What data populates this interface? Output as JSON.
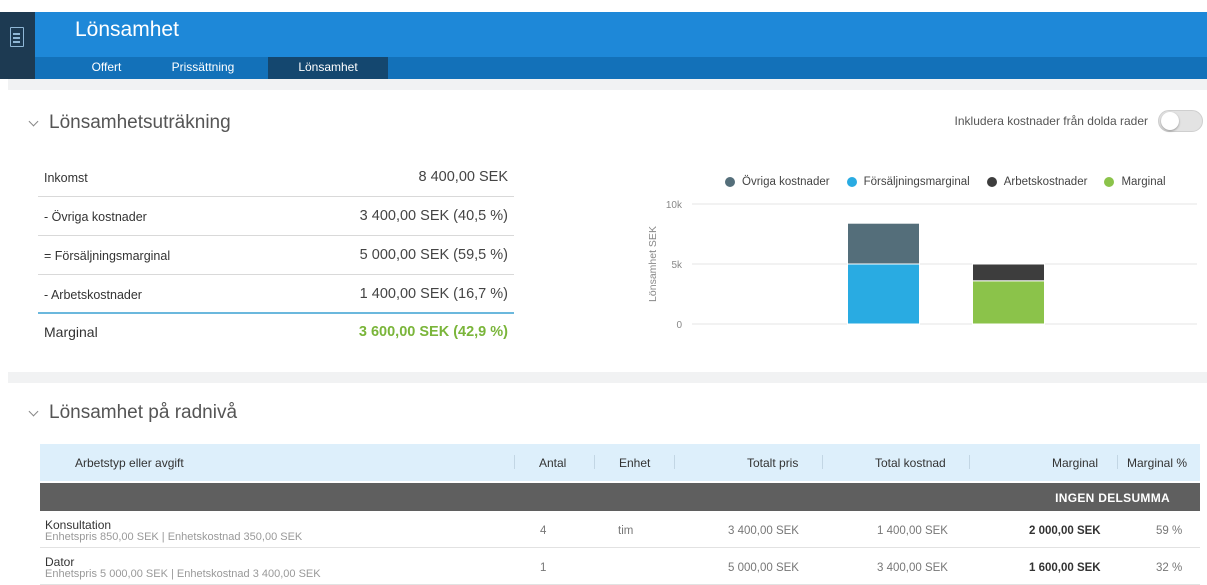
{
  "header": {
    "title": "Lönsamhet",
    "tabs": [
      {
        "label": "Offert"
      },
      {
        "label": "Prissättning"
      },
      {
        "label": "Lönsamhet"
      }
    ],
    "active_tab": "Lönsamhet",
    "colors": {
      "title_bar": "#1e88d8",
      "tab_bar": "#1371b9",
      "active_tab": "#14476f"
    }
  },
  "calculation": {
    "title": "Lönsamhetsuträkning",
    "toggle_label": "Inkludera kostnader från dolda rader",
    "toggle_on": false,
    "rows": [
      {
        "label": "Inkomst",
        "value": "8 400,00 SEK"
      },
      {
        "label": "- Övriga kostnader",
        "value": "3 400,00 SEK  (40,5 %)"
      },
      {
        "label": "= Försäljningsmarginal",
        "value": "5 000,00 SEK  (59,5 %)"
      },
      {
        "label": "- Arbetskostnader",
        "value": "1 400,00 SEK  (16,7 %)"
      }
    ],
    "total": {
      "label": "Marginal",
      "value": "3 600,00 SEK  (42,9 %)"
    }
  },
  "chart_data": {
    "type": "bar",
    "stacked": true,
    "ylabel": "Lönsamhet SEK",
    "ylim": [
      0,
      10000
    ],
    "yticks": [
      {
        "value": 0,
        "label": "0"
      },
      {
        "value": 5000,
        "label": "5k"
      },
      {
        "value": 10000,
        "label": "10k"
      }
    ],
    "grid": true,
    "legend_position": "top",
    "legend": [
      {
        "name": "Övriga kostnader",
        "color": "#546e7a"
      },
      {
        "name": "Försäljningsmarginal",
        "color": "#29abe2"
      },
      {
        "name": "Arbetskostnader",
        "color": "#3d3d3d"
      },
      {
        "name": "Marginal",
        "color": "#8bc34a"
      }
    ],
    "bars": [
      {
        "segments": [
          {
            "series": "Försäljningsmarginal",
            "value": 5000
          },
          {
            "series": "Övriga kostnader",
            "value": 3400
          }
        ]
      },
      {
        "segments": [
          {
            "series": "Marginal",
            "value": 3600
          },
          {
            "series": "Arbetskostnader",
            "value": 1400
          }
        ]
      }
    ]
  },
  "line_profit": {
    "title": "Lönsamhet på radnivå",
    "columns": [
      "Arbetstyp eller avgift",
      "Antal",
      "Enhet",
      "Totalt pris",
      "Total kostnad",
      "Marginal",
      "Marginal %"
    ],
    "subtotal_label": "INGEN DELSUMMA",
    "rows": [
      {
        "name": "Konsultation",
        "details": "Enhetspris 850,00 SEK   |   Enhetskostnad 350,00 SEK",
        "antal": "4",
        "enhet": "tim",
        "total_price": "3 400,00 SEK",
        "total_cost": "1 400,00 SEK",
        "margin": "2 000,00 SEK",
        "margin_pct": "59 %"
      },
      {
        "name": "Dator",
        "details": "Enhetspris 5 000,00 SEK   |   Enhetskostnad 3 400,00 SEK",
        "antal": "1",
        "enhet": "",
        "total_price": "5 000,00 SEK",
        "total_cost": "3 400,00 SEK",
        "margin": "1 600,00 SEK",
        "margin_pct": "32 %"
      }
    ]
  }
}
